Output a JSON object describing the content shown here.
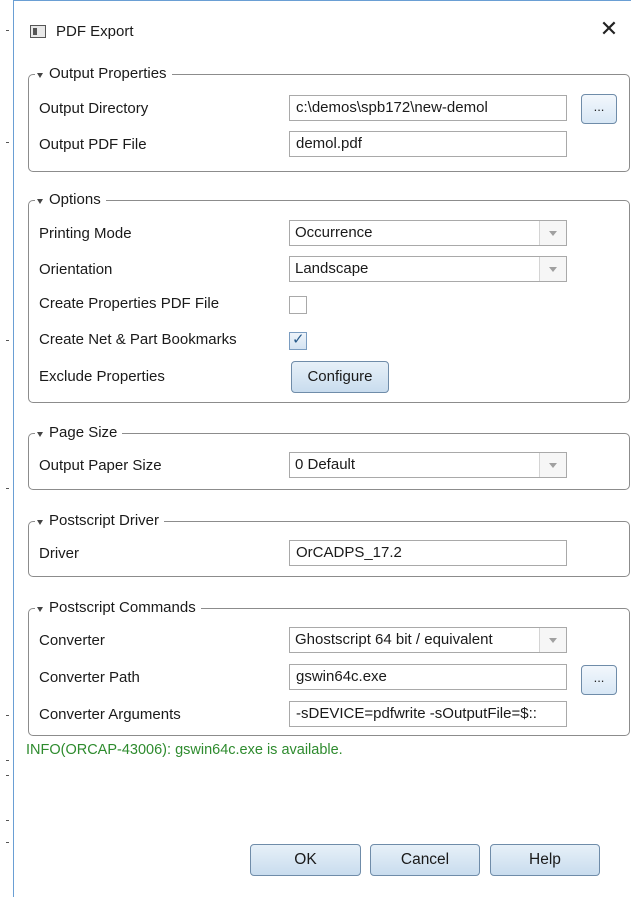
{
  "window": {
    "title": "PDF Export",
    "close_glyph": "✕"
  },
  "output_properties": {
    "legend": "Output Properties",
    "output_directory_label": "Output Directory",
    "output_directory_value": "c:\\demos\\spb172\\new-demol",
    "browse_label": "...",
    "output_pdf_label": "Output PDF File",
    "output_pdf_value": "demol.pdf"
  },
  "options": {
    "legend": "Options",
    "printing_mode_label": "Printing Mode",
    "printing_mode_value": "Occurrence",
    "orientation_label": "Orientation",
    "orientation_value": "Landscape",
    "create_props_label": "Create Properties PDF File",
    "create_props_checked": false,
    "create_bookmarks_label": "Create Net & Part Bookmarks",
    "create_bookmarks_checked": true,
    "exclude_props_label": "Exclude Properties",
    "configure_label": "Configure"
  },
  "page_size": {
    "legend": "Page Size",
    "paper_size_label": "Output Paper Size",
    "paper_size_value": "0 Default"
  },
  "postscript_driver": {
    "legend": "Postscript Driver",
    "driver_label": "Driver",
    "driver_value": "OrCADPS_17.2"
  },
  "postscript_commands": {
    "legend": "Postscript Commands",
    "converter_label": "Converter",
    "converter_value": "Ghostscript 64 bit / equivalent",
    "converter_path_label": "Converter Path",
    "converter_path_value": "gswin64c.exe",
    "browse_label": "...",
    "converter_args_label": "Converter Arguments",
    "converter_args_value": "-sDEVICE=pdfwrite -sOutputFile=$::"
  },
  "status": {
    "info": "INFO(ORCAP-43006): gswin64c.exe is available.",
    "info_color": "#2e8b2e"
  },
  "buttons": {
    "ok": "OK",
    "cancel": "Cancel",
    "help": "Help"
  },
  "icons": {
    "app": "pdf-export-window-icon",
    "close": "close-icon",
    "collapse": "collapse-triangle-icon",
    "check": "checkmark-icon",
    "dropdown": "chevron-down-icon"
  }
}
